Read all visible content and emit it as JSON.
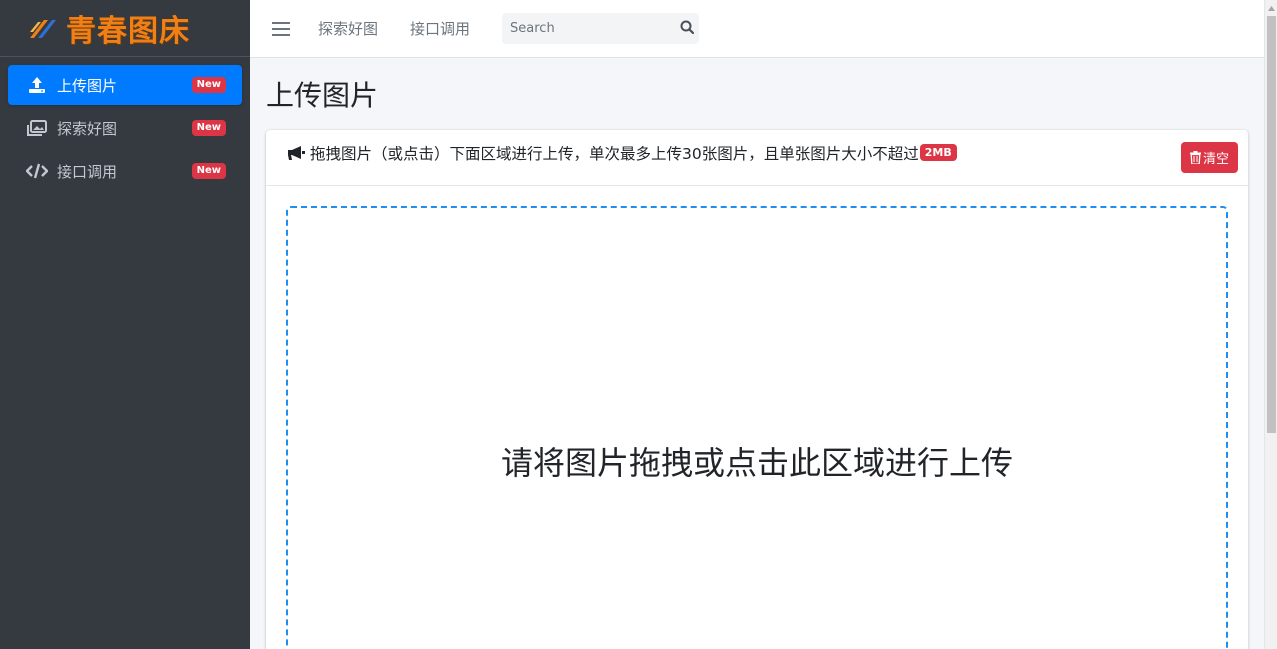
{
  "brand": {
    "name": "青春图床"
  },
  "sidebar": {
    "items": [
      {
        "label": "上传图片",
        "badge": "New",
        "icon": "upload-icon",
        "active": true
      },
      {
        "label": "探索好图",
        "badge": "New",
        "icon": "images-icon",
        "active": false
      },
      {
        "label": "接口调用",
        "badge": "New",
        "icon": "code-icon",
        "active": false
      }
    ]
  },
  "header": {
    "links": [
      "探索好图",
      "接口调用"
    ],
    "search": {
      "placeholder": "Search",
      "value": ""
    }
  },
  "main": {
    "title": "上传图片",
    "notice": "拖拽图片（或点击）下面区域进行上传，单次最多上传30张图片，且单张图片大小不超过",
    "size_badge": "2MB",
    "clear_label": "清空",
    "dropzone_text": "请将图片拖拽或点击此区域进行上传"
  },
  "colors": {
    "sidebar_bg": "#343a40",
    "accent": "#007bff",
    "danger": "#dc3545",
    "brand": "#f07f16",
    "dropzone_border": "#1e8ef0"
  }
}
